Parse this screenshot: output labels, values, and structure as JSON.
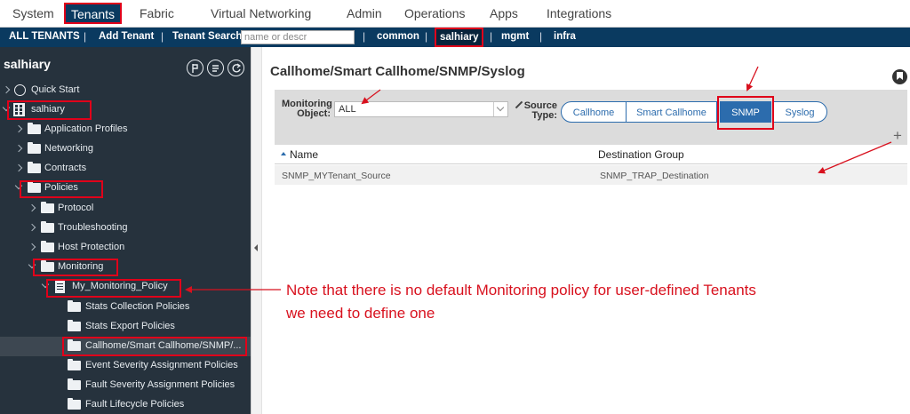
{
  "top_menu": {
    "items": [
      {
        "label": "System"
      },
      {
        "label": "Tenants",
        "active": true
      },
      {
        "label": "Fabric"
      },
      {
        "label": "Virtual Networking"
      },
      {
        "label": "Admin"
      },
      {
        "label": "Operations"
      },
      {
        "label": "Apps"
      },
      {
        "label": "Integrations"
      }
    ]
  },
  "sub_menu": {
    "all_tenants": "ALL TENANTS",
    "add_tenant": "Add Tenant",
    "tenant_search_label": "Tenant Search:",
    "tenant_search_placeholder": "name or descr",
    "common": "common",
    "salhiary": "salhiary",
    "mgmt": "mgmt",
    "infra": "infra"
  },
  "sidebar": {
    "title": "salhiary",
    "tree": [
      {
        "label": "Quick Start"
      },
      {
        "label": "salhiary"
      },
      {
        "label": "Application Profiles"
      },
      {
        "label": "Networking"
      },
      {
        "label": "Contracts"
      },
      {
        "label": "Policies"
      },
      {
        "label": "Protocol"
      },
      {
        "label": "Troubleshooting"
      },
      {
        "label": "Host Protection"
      },
      {
        "label": "Monitoring"
      },
      {
        "label": "My_Monitoring_Policy"
      },
      {
        "label": "Stats Collection Policies"
      },
      {
        "label": "Stats Export Policies"
      },
      {
        "label": "Callhome/Smart Callhome/SNMP/...",
        "selected": true
      },
      {
        "label": "Event Severity Assignment Policies"
      },
      {
        "label": "Fault Severity Assignment Policies"
      },
      {
        "label": "Fault Lifecycle Policies"
      }
    ]
  },
  "main": {
    "title": "Callhome/Smart Callhome/SNMP/Syslog",
    "monitoring_object_label": "Monitoring Object:",
    "monitoring_object_value": "ALL",
    "source_type_label": "Source Type:",
    "source_types": [
      {
        "label": "Callhome"
      },
      {
        "label": "Smart Callhome"
      },
      {
        "label": "SNMP",
        "selected": true
      },
      {
        "label": "Syslog"
      }
    ],
    "table": {
      "columns": [
        "Name",
        "Destination Group"
      ],
      "rows": [
        [
          "SNMP_MYTenant_Source",
          "SNMP_TRAP_Destination"
        ]
      ]
    }
  },
  "annotation": {
    "line1": "Note that there is no default Monitoring policy for user-defined Tenants",
    "line2": "we need to define one",
    "color": "#d8111e"
  },
  "colors": {
    "nav_dark": "#0a3a60",
    "sidebar_bg": "#26323d",
    "accent_blue": "#2c6cad",
    "highlight_red": "#e0001a"
  }
}
